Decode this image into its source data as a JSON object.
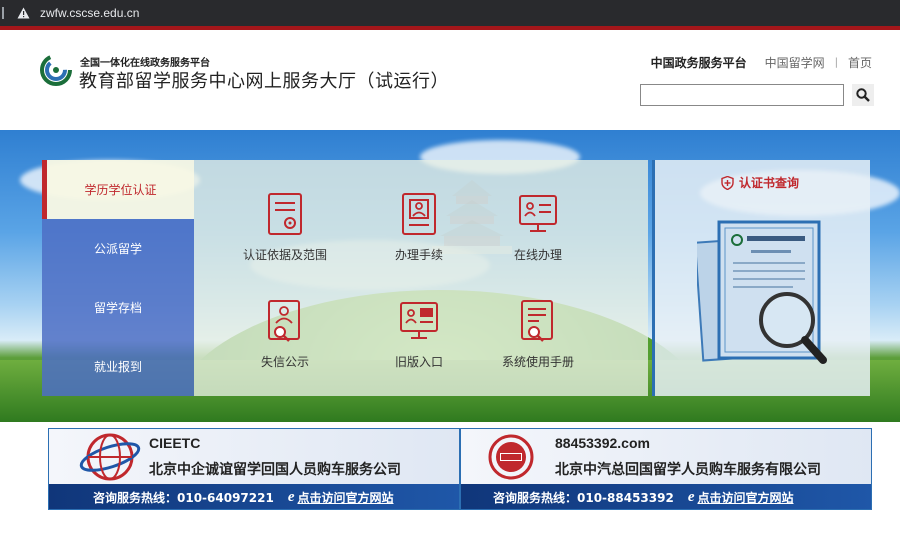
{
  "browser": {
    "url": "zwfw.cscse.edu.cn"
  },
  "header": {
    "subtitle": "全国一体化在线政务服务平台",
    "title": "教育部留学服务中心网上服务大厅（试运行）",
    "links": [
      "中国政务服务平台",
      "中国留学网",
      "首页"
    ],
    "search_placeholder": ""
  },
  "tabs": [
    {
      "label": "学历学位认证",
      "active": true
    },
    {
      "label": "公派留学",
      "active": false
    },
    {
      "label": "留学存档",
      "active": false
    },
    {
      "label": "就业报到",
      "active": false
    }
  ],
  "services": [
    {
      "label": "认证依据及范围",
      "icon": "document-seal-icon"
    },
    {
      "label": "办理手续",
      "icon": "person-card-icon"
    },
    {
      "label": "在线办理",
      "icon": "monitor-profile-icon"
    },
    {
      "label": "失信公示",
      "icon": "person-search-icon"
    },
    {
      "label": "旧版入口",
      "icon": "old-version-monitor-icon"
    },
    {
      "label": "系统使用手册",
      "icon": "manual-search-icon"
    }
  ],
  "cert": {
    "title": "认证书查询"
  },
  "ads": [
    {
      "name": "CIEETC",
      "company": "北京中企诚谊留学回国人员购车服务公司",
      "hotline": "咨询服务热线：010-64097221",
      "visit": "点击访问官方网站"
    },
    {
      "name": "88453392.com",
      "company": "北京中汽总回国留学人员购车服务有限公司",
      "hotline": "咨询服务热线：010-88453392",
      "visit": "点击访问官方网站"
    }
  ],
  "colors": {
    "brand_red": "#c0282d",
    "tab_blue": "#4e6ec4",
    "header_red_line": "#a4161a"
  }
}
